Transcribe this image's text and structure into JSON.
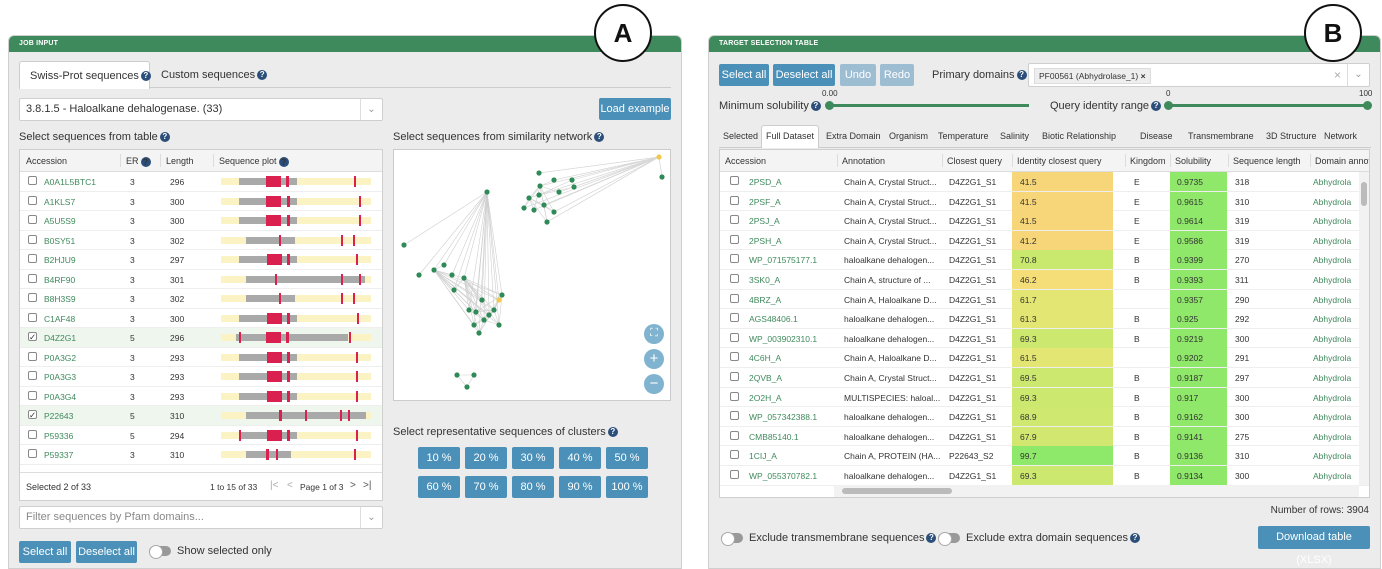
{
  "markers": {
    "a": "A",
    "b": "B"
  },
  "left": {
    "header": "JOB INPUT",
    "tabs": [
      {
        "label": "Swiss-Prot sequences"
      },
      {
        "label": "Custom sequences"
      }
    ],
    "ec_select": "3.8.1.5 - Haloalkane dehalogenase. (33)",
    "load_example": "Load example",
    "table_title": "Select sequences from table",
    "columns": [
      "Accession",
      "ER",
      "Length",
      "Sequence plot"
    ],
    "rows": [
      {
        "acc": "A0A1L5BTC1",
        "er": "3",
        "len": "296",
        "checked": false
      },
      {
        "acc": "A1KLS7",
        "er": "3",
        "len": "300",
        "checked": false
      },
      {
        "acc": "A5U5S9",
        "er": "3",
        "len": "300",
        "checked": false
      },
      {
        "acc": "B0SY51",
        "er": "3",
        "len": "302",
        "checked": false
      },
      {
        "acc": "B2HJU9",
        "er": "3",
        "len": "297",
        "checked": false
      },
      {
        "acc": "B4RF90",
        "er": "3",
        "len": "301",
        "checked": false
      },
      {
        "acc": "B8H3S9",
        "er": "3",
        "len": "302",
        "checked": false
      },
      {
        "acc": "C1AF48",
        "er": "3",
        "len": "300",
        "checked": false
      },
      {
        "acc": "D4Z2G1",
        "er": "5",
        "len": "296",
        "checked": true
      },
      {
        "acc": "P0A3G2",
        "er": "3",
        "len": "293",
        "checked": false
      },
      {
        "acc": "P0A3G3",
        "er": "3",
        "len": "293",
        "checked": false
      },
      {
        "acc": "P0A3G4",
        "er": "3",
        "len": "293",
        "checked": false
      },
      {
        "acc": "P22643",
        "er": "5",
        "len": "310",
        "checked": true
      },
      {
        "acc": "P59336",
        "er": "5",
        "len": "294",
        "checked": false
      },
      {
        "acc": "P59337",
        "er": "3",
        "len": "310",
        "checked": false
      }
    ],
    "footer_selected": "Selected 2 of 33",
    "footer_range": "1 to 15 of 33",
    "footer_page": "Page 1 of 3",
    "pfam_placeholder": "Filter sequences by Pfam domains...",
    "select_all": "Select all",
    "deselect_all": "Deselect all",
    "show_selected": "Show selected only",
    "network_title": "Select sequences from similarity network",
    "clusters_title": "Select representative sequences of clusters",
    "cluster_buttons": [
      "10 %",
      "20 %",
      "30 %",
      "40 %",
      "50 %",
      "60 %",
      "70 %",
      "80 %",
      "90 %",
      "100 %"
    ],
    "node_color": "#2e8b57",
    "highlight_color": "#f2c94c"
  },
  "right": {
    "header": "TARGET SELECTION TABLE",
    "buttons": {
      "select_all": "Select all",
      "deselect_all": "Deselect all",
      "undo": "Undo",
      "redo": "Redo"
    },
    "primary_domains_label": "Primary domains",
    "primary_domain_tag": "PF00561 (Abhydrolase_1)",
    "min_solubility_label": "Minimum solubility",
    "min_solubility_value": "0.00",
    "identity_label": "Query identity range",
    "identity_min": "0",
    "identity_max": "100",
    "tabs": [
      "Selected",
      "Full Dataset",
      "Extra Domain",
      "Organism",
      "Temperature",
      "Salinity",
      "Biotic Relationship",
      "Disease",
      "Transmembrane",
      "3D Structure",
      "Network"
    ],
    "active_tab": "Full Dataset",
    "columns": [
      "Accession",
      "Annotation",
      "Closest query",
      "Identity closest query",
      "Kingdom",
      "Solubility",
      "Sequence length",
      "Domain annot"
    ],
    "rows": [
      {
        "acc": "2PSD_A",
        "ann": "Chain A, Crystal Struct...",
        "cq": "D4Z2G1_S1",
        "id": "41.5",
        "kg": "E",
        "sol": "0.9735",
        "len": "318",
        "dom": "Abhydrola",
        "color": "#f7d67a"
      },
      {
        "acc": "2PSF_A",
        "ann": "Chain A, Crystal Struct...",
        "cq": "D4Z2G1_S1",
        "id": "41.5",
        "kg": "E",
        "sol": "0.9615",
        "len": "310",
        "dom": "Abhydrola",
        "color": "#f7d67a"
      },
      {
        "acc": "2PSJ_A",
        "ann": "Chain A, Crystal Struct...",
        "cq": "D4Z2G1_S1",
        "id": "41.5",
        "kg": "E",
        "sol": "0.9614",
        "len": "319",
        "dom": "Abhydrola",
        "color": "#f7d67a"
      },
      {
        "acc": "2PSH_A",
        "ann": "Chain A, Crystal Struct...",
        "cq": "D4Z2G1_S1",
        "id": "41.2",
        "kg": "E",
        "sol": "0.9586",
        "len": "319",
        "dom": "Abhydrola",
        "color": "#f7d67a"
      },
      {
        "acc": "WP_071575177.1",
        "ann": "haloalkane dehalogen...",
        "cq": "D4Z2G1_S1",
        "id": "70.8",
        "kg": "B",
        "sol": "0.9399",
        "len": "270",
        "dom": "Abhydrola",
        "color": "#c9e86e"
      },
      {
        "acc": "3SK0_A",
        "ann": "Chain A, structure of ...",
        "cq": "D4Z2G1_S1",
        "id": "46.2",
        "kg": "B",
        "sol": "0.9393",
        "len": "311",
        "dom": "Abhydrola",
        "color": "#f5dd78"
      },
      {
        "acc": "4BRZ_A",
        "ann": "Chain A, Haloalkane D...",
        "cq": "D4Z2G1_S1",
        "id": "61.7",
        "kg": "",
        "sol": "0.9357",
        "len": "290",
        "dom": "Abhydrola",
        "color": "#e3e673"
      },
      {
        "acc": "AGS48406.1",
        "ann": "haloalkane dehalogen...",
        "cq": "D4Z2G1_S1",
        "id": "61.3",
        "kg": "B",
        "sol": "0.925",
        "len": "292",
        "dom": "Abhydrola",
        "color": "#e3e673"
      },
      {
        "acc": "WP_003902310.1",
        "ann": "haloalkane dehalogen...",
        "cq": "D4Z2G1_S1",
        "id": "69.3",
        "kg": "B",
        "sol": "0.9219",
        "len": "300",
        "dom": "Abhydrola",
        "color": "#cde86f"
      },
      {
        "acc": "4C6H_A",
        "ann": "Chain A, Haloalkane D...",
        "cq": "D4Z2G1_S1",
        "id": "61.5",
        "kg": "",
        "sol": "0.9202",
        "len": "291",
        "dom": "Abhydrola",
        "color": "#e3e673"
      },
      {
        "acc": "2QVB_A",
        "ann": "Chain A, Crystal Struct...",
        "cq": "D4Z2G1_S1",
        "id": "69.5",
        "kg": "B",
        "sol": "0.9187",
        "len": "297",
        "dom": "Abhydrola",
        "color": "#cde86f"
      },
      {
        "acc": "2O2H_A",
        "ann": "MULTISPECIES: haloal...",
        "cq": "D4Z2G1_S1",
        "id": "69.3",
        "kg": "B",
        "sol": "0.917",
        "len": "300",
        "dom": "Abhydrola",
        "color": "#cde86f"
      },
      {
        "acc": "WP_057342388.1",
        "ann": "haloalkane dehalogen...",
        "cq": "D4Z2G1_S1",
        "id": "68.9",
        "kg": "B",
        "sol": "0.9162",
        "len": "300",
        "dom": "Abhydrola",
        "color": "#cfe86f"
      },
      {
        "acc": "CMB85140.1",
        "ann": "haloalkane dehalogen...",
        "cq": "D4Z2G1_S1",
        "id": "67.9",
        "kg": "B",
        "sol": "0.9141",
        "len": "275",
        "dom": "Abhydrola",
        "color": "#d1e770"
      },
      {
        "acc": "1CIJ_A",
        "ann": "Chain A, PROTEIN (HA...",
        "cq": "P22643_S2",
        "id": "99.7",
        "kg": "B",
        "sol": "0.9136",
        "len": "310",
        "dom": "Abhydrola",
        "color": "#8ee86a"
      },
      {
        "acc": "WP_055370782.1",
        "ann": "haloalkane dehalogen...",
        "cq": "D4Z2G1_S1",
        "id": "69.3",
        "kg": "B",
        "sol": "0.9134",
        "len": "300",
        "dom": "Abhydrola",
        "color": "#cde86f"
      }
    ],
    "num_rows": "Number of rows: 3904",
    "exclude_tm": "Exclude transmembrane sequences",
    "exclude_extra": "Exclude extra domain sequences",
    "download": "Download table (XLSX)",
    "solubility_color": "#8fe86a"
  }
}
